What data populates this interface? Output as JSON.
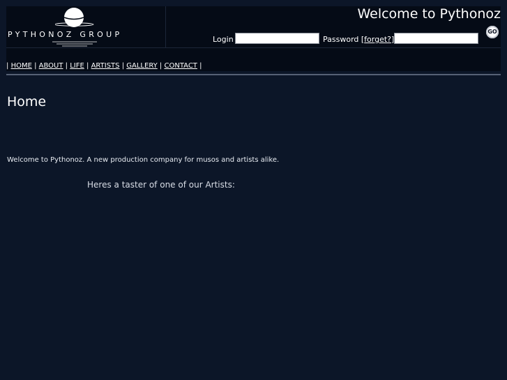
{
  "header": {
    "logo_text": "PYTHONOZ GROUP",
    "welcome": "Welcome to Pythonoz",
    "login_label": "Login",
    "password_label": "Password [",
    "forgot_link": "forget?",
    "forgot_close": "]",
    "login_value": "",
    "password_value": "",
    "go_label": "GO"
  },
  "nav": {
    "items": [
      "HOME",
      "ABOUT",
      "LIFE",
      "ARTISTS",
      "GALLERY",
      "CONTACT"
    ],
    "separator": "|"
  },
  "main": {
    "title": "Home",
    "intro": "Welcome to Pythonoz. A new production company for musos and artists alike.",
    "taster": "Heres a taster of one of our Artists:"
  },
  "colors": {
    "background": "#0c1628",
    "header_bg": "#050b16",
    "rule": "#566175",
    "text": "#ffffff"
  }
}
